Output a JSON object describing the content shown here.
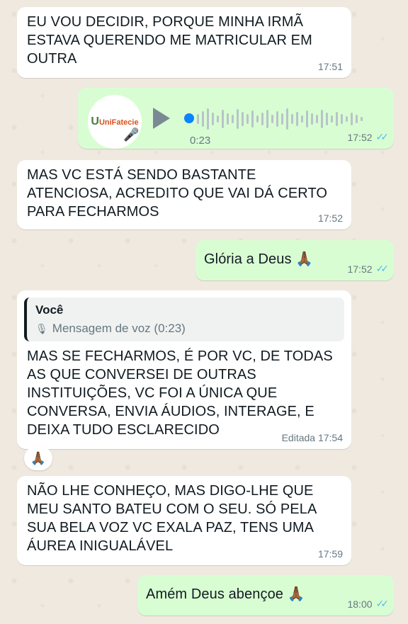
{
  "messages": {
    "m1": {
      "text": "EU VOU DECIDIR, PORQUE MINHA IRMÃ ESTAVA QUERENDO ME MATRICULAR EM OUTRA",
      "time": "17:51"
    },
    "voice": {
      "avatar_logo": "UniFatecie",
      "duration": "0:23",
      "time": "17:52",
      "icon": "play-icon"
    },
    "m2": {
      "text": "MAS VC ESTÁ SENDO BASTANTE ATENCIOSA, ACREDITO QUE VAI DÁ CERTO PARA FECHARMOS",
      "time": "17:52"
    },
    "m3": {
      "text": "Glória a Deus 🙏🏾",
      "time": "17:52"
    },
    "m4": {
      "quote_author": "Você",
      "quote_text": "Mensagem de voz (0:23)",
      "text": "MAS SE FECHARMOS,  É POR VC, DE TODAS AS QUE CONVERSEI DE OUTRAS INSTITUIÇÕES,  VC FOI A ÚNICA QUE CONVERSA, ENVIA ÁUDIOS,  INTERAGE, E DEIXA TUDO ESCLARECIDO",
      "time": "Editada 17:54",
      "reaction": "🙏🏾"
    },
    "m5": {
      "text": "NÃO LHE CONHEÇO,  MAS DIGO-LHE QUE MEU SANTO BATEU COM O SEU. SÓ PELA SUA BELA VOZ VC EXALA PAZ, TENS UMA ÁUREA INIGUALÁVEL",
      "time": "17:59"
    },
    "m6": {
      "text": "Amém Deus abençoe 🙏🏾",
      "time": "18:00"
    }
  },
  "colors": {
    "incoming": "#ffffff",
    "outgoing": "#d9fdd3",
    "read_ticks": "#53bdeb",
    "background": "#efe9e0"
  }
}
